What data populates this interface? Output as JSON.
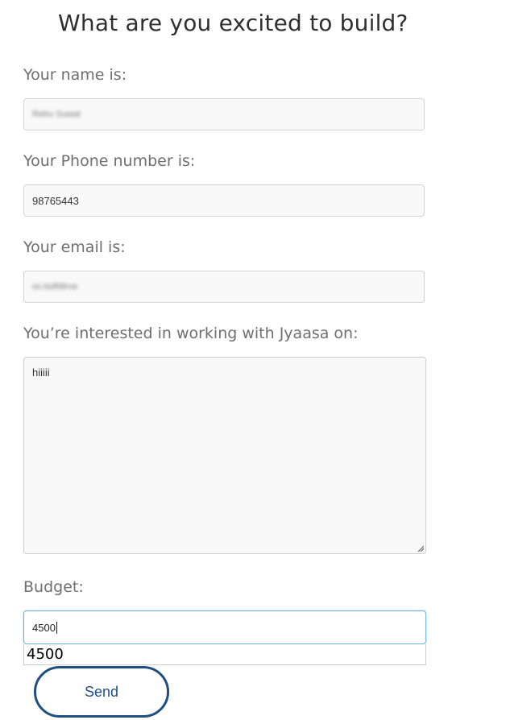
{
  "form": {
    "title": "What are you excited to build?",
    "name": {
      "label": "Your name is:",
      "value": "Rehu Suwat"
    },
    "phone": {
      "label": "Your Phone number is:",
      "value": "98765443"
    },
    "email": {
      "label": "Your email is:",
      "value": "ss.tsdfdtrve"
    },
    "interest": {
      "label": "You’re interested in working with Jyaasa on:",
      "value": "hiiiii"
    },
    "budget": {
      "label": "Budget:",
      "value": "4500",
      "suggestion": "4500"
    },
    "submit_label": "Send"
  },
  "colors": {
    "button_accent": "#1f4e80",
    "focus_border": "#6bb3d9"
  }
}
